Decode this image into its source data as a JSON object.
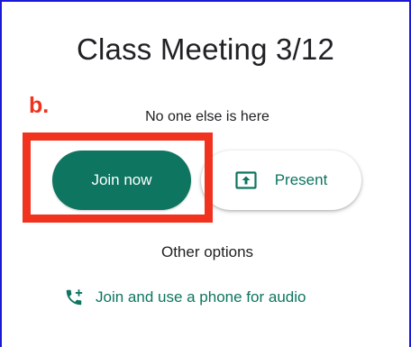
{
  "meeting": {
    "title": "Class Meeting 3/12",
    "status": "No one else is here"
  },
  "annotation": {
    "label": "b.",
    "color": "#f0321e"
  },
  "actions": {
    "join_label": "Join now",
    "present_label": "Present",
    "present_icon": "present-screen-icon"
  },
  "other_options": {
    "heading": "Other options",
    "phone_audio_label": "Join and use a phone for audio",
    "phone_icon": "phone-add-icon"
  },
  "colors": {
    "brand": "#0d7560",
    "annotation": "#f0321e",
    "frame": "#1a1ad6"
  }
}
